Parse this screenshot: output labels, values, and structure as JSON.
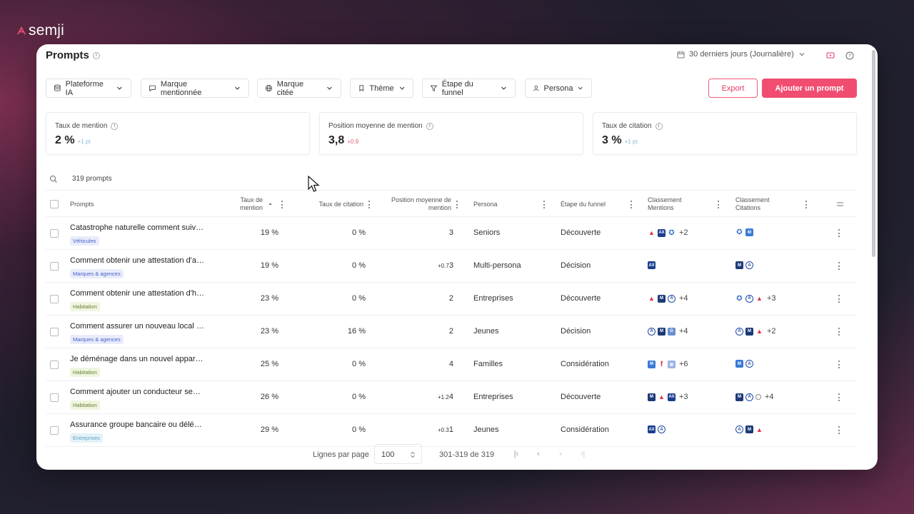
{
  "brand": {
    "name": "semji"
  },
  "page": {
    "title": "Prompts"
  },
  "header": {
    "date_range": "30 derniers jours (Journalière)"
  },
  "filters": [
    {
      "label": "Plateforme IA",
      "icon": "database-icon"
    },
    {
      "label": "Marque mentionnée",
      "icon": "message-square-icon"
    },
    {
      "label": "Marque citée",
      "icon": "globe-icon"
    },
    {
      "label": "Thème",
      "icon": "bookmark-icon"
    },
    {
      "label": "Étape du funnel",
      "icon": "funnel-icon"
    },
    {
      "label": "Persona",
      "icon": "user-icon"
    }
  ],
  "actions": {
    "export": "Export",
    "add": "Ajouter un prompt"
  },
  "kpis": [
    {
      "label": "Taux de mention",
      "value": "2 %",
      "delta": "+1 pt"
    },
    {
      "label": "Position moyenne de mention",
      "value": "3,8",
      "delta": "+0.9"
    },
    {
      "label": "Taux de citation",
      "value": "3 %",
      "delta": "+1 pt"
    }
  ],
  "search": {
    "count": "319 prompts"
  },
  "table": {
    "headers": {
      "prompts": "Prompts",
      "mention_rate": "Taux de mention",
      "citation_rate": "Taux de citation",
      "avg_position": "Position moyenne de mention",
      "persona": "Persona",
      "funnel": "Étape du funnel",
      "rank_mentions": "Classement Mentions",
      "rank_citations": "Classement Citations"
    },
    "rows": [
      {
        "prompt": "Catastrophe naturelle comment suivre mon dossier",
        "tag": "Véhicules",
        "tag_color": "blue",
        "mention": "19 %",
        "citation": "0 %",
        "position": "3",
        "pos_delta": "",
        "persona": "Seniors",
        "funnel": "Découverte",
        "mentions_more": "+2",
        "citations_more": ""
      },
      {
        "prompt": "Comment obtenir une attestation d'assurance",
        "tag": "Marques & agences",
        "tag_color": "blue",
        "mention": "19 %",
        "citation": "0 %",
        "position": "3",
        "pos_delta": "+0.7",
        "persona": "Multi-persona",
        "funnel": "Décision",
        "mentions_more": "",
        "citations_more": ""
      },
      {
        "prompt": "Comment obtenir une attestation d'habitation",
        "tag": "Habitation",
        "tag_color": "green",
        "mention": "23 %",
        "citation": "0 %",
        "position": "2",
        "pos_delta": "",
        "persona": "Entreprises",
        "funnel": "Découverte",
        "mentions_more": "+4",
        "citations_more": "+3"
      },
      {
        "prompt": "Comment assurer un nouveau local professionnel",
        "tag": "Marques & agences",
        "tag_color": "blue",
        "mention": "23 %",
        "citation": "16 %",
        "position": "2",
        "pos_delta": "",
        "persona": "Jeunes",
        "funnel": "Décision",
        "mentions_more": "+4",
        "citations_more": "+2"
      },
      {
        "prompt": "Je déménage dans un nouvel appartement",
        "tag": "Habitation",
        "tag_color": "green",
        "mention": "25 %",
        "citation": "0 %",
        "position": "4",
        "pos_delta": "",
        "persona": "Familles",
        "funnel": "Considération",
        "mentions_more": "+6",
        "citations_more": ""
      },
      {
        "prompt": "Comment ajouter un conducteur secondaire",
        "tag": "Habitation",
        "tag_color": "green",
        "mention": "26 %",
        "citation": "0 %",
        "position": "4",
        "pos_delta": "+1.2",
        "persona": "Entreprises",
        "funnel": "Découverte",
        "mentions_more": "+3",
        "citations_more": "+4"
      },
      {
        "prompt": "Assurance groupe bancaire ou délégation",
        "tag": "Entreprises",
        "tag_color": "cyan",
        "mention": "29 %",
        "citation": "0 %",
        "position": "1",
        "pos_delta": "+0.3",
        "persona": "Jeunes",
        "funnel": "Considération",
        "mentions_more": "",
        "citations_more": ""
      }
    ]
  },
  "footer": {
    "rows_label": "Lignes par page",
    "rows_value": "100",
    "range": "301-319 de 319"
  },
  "colors": {
    "accent": "#f04d71",
    "delta_positive": "#8ab8d8",
    "delta_negative": "#e5566f"
  }
}
